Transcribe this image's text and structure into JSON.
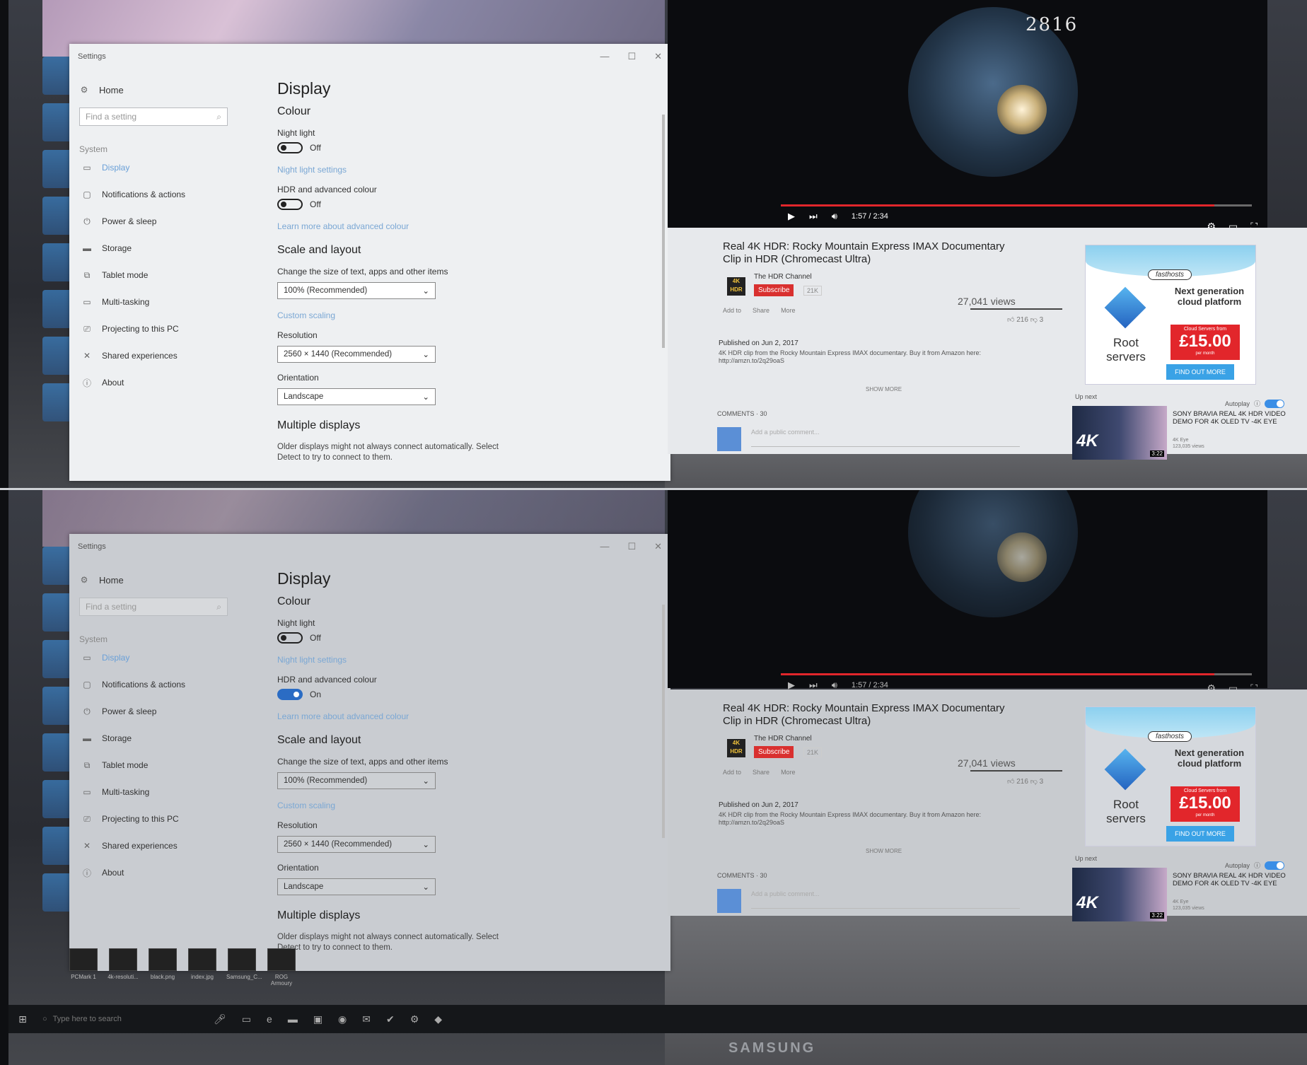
{
  "top": {
    "settings": {
      "title": "Settings",
      "win_controls": [
        "—",
        "☐",
        "✕"
      ],
      "nav": {
        "home": "Home",
        "search_placeholder": "Find a setting",
        "section": "System",
        "items": [
          {
            "label": "Display",
            "icon": "monitor-icon"
          },
          {
            "label": "Notifications & actions",
            "icon": "notification-icon"
          },
          {
            "label": "Power & sleep",
            "icon": "power-icon"
          },
          {
            "label": "Storage",
            "icon": "storage-icon"
          },
          {
            "label": "Tablet mode",
            "icon": "tablet-icon"
          },
          {
            "label": "Multi-tasking",
            "icon": "multitask-icon"
          },
          {
            "label": "Projecting to this PC",
            "icon": "projector-icon"
          },
          {
            "label": "Shared experiences",
            "icon": "shared-icon"
          },
          {
            "label": "About",
            "icon": "info-icon"
          }
        ]
      },
      "content": {
        "heading": "Display",
        "colour": "Colour",
        "night_light_label": "Night light",
        "night_light_state": "Off",
        "night_light_link": "Night light settings",
        "hdr_label": "HDR and advanced colour",
        "hdr_state": "Off",
        "hdr_link": "Learn more about advanced colour",
        "scale_heading": "Scale and layout",
        "scale_label": "Change the size of text, apps and other items",
        "scale_value": "100% (Recommended)",
        "custom_scaling": "Custom scaling",
        "resolution_label": "Resolution",
        "resolution_value": "2560 × 1440 (Recommended)",
        "orientation_label": "Orientation",
        "orientation_value": "Landscape",
        "multi_heading": "Multiple displays",
        "multi_text": "Older displays might not always connect automatically. Select Detect to try to connect to them."
      }
    },
    "video": {
      "number": "2816",
      "time": "1:57 / 2:34",
      "progress": 0.92
    },
    "youtube": {
      "title": "Real 4K HDR: Rocky Mountain Express IMAX Documentary Clip in HDR (Chromecast Ultra)",
      "badge_top": "4K",
      "badge_bottom": "HDR",
      "channel": "The HDR Channel",
      "subscribe": "Subscribe",
      "subcount": "21K",
      "views": "27,041 views",
      "actions": [
        "Add to",
        "Share",
        "More"
      ],
      "likes": "216",
      "dislikes": "3",
      "published": "Published on Jun 2, 2017",
      "description": "4K HDR clip from the Rocky Mountain Express IMAX documentary. Buy it from Amazon here: http://amzn.to/2q29oaS",
      "show_more": "SHOW MORE",
      "comments": "COMMENTS · 30",
      "comment_placeholder": "Add a public comment...",
      "ad": {
        "brand": "fasthosts",
        "headline": "Next generation cloud platform",
        "root": "Root servers",
        "price_top": "Cloud Servers from",
        "price": "£15.00",
        "price_bottom": "per month",
        "button": "FIND OUT MORE"
      },
      "up_next": "Up next",
      "autoplay": "Autoplay",
      "next_title": "SONY BRAVIA REAL 4K HDR VIDEO DEMO FOR 4K OLED TV -4K EYE",
      "next_channel": "4K Eye",
      "next_views": "123,035 views",
      "next_duration": "3:22",
      "thumb_label": "4K"
    }
  },
  "bottom": {
    "settings": {
      "title": "Settings",
      "nav": {
        "home": "Home",
        "search_placeholder": "Find a setting",
        "section": "System",
        "items": [
          {
            "label": "Display"
          },
          {
            "label": "Notifications & actions"
          },
          {
            "label": "Power & sleep"
          },
          {
            "label": "Storage"
          },
          {
            "label": "Tablet mode"
          },
          {
            "label": "Multi-tasking"
          },
          {
            "label": "Projecting to this PC"
          },
          {
            "label": "Shared experiences"
          },
          {
            "label": "About"
          }
        ]
      },
      "content": {
        "heading": "Display",
        "colour": "Colour",
        "night_light_label": "Night light",
        "night_light_state": "Off",
        "night_light_link": "Night light settings",
        "hdr_label": "HDR and advanced colour",
        "hdr_state": "On",
        "hdr_link": "Learn more about advanced colour",
        "scale_heading": "Scale and layout",
        "scale_label": "Change the size of text, apps and other items",
        "scale_value": "100% (Recommended)",
        "custom_scaling": "Custom scaling",
        "resolution_label": "Resolution",
        "resolution_value": "2560 × 1440 (Recommended)",
        "orientation_label": "Orientation",
        "orientation_value": "Landscape",
        "multi_heading": "Multiple displays",
        "multi_text": "Older displays might not always connect automatically. Select Detect to try to connect to them."
      }
    },
    "video": {
      "time": "1:57 / 2:34",
      "progress": 0.92
    },
    "youtube": {
      "title": "Real 4K HDR: Rocky Mountain Express IMAX Documentary Clip in HDR (Chromecast Ultra)",
      "badge_top": "4K",
      "badge_bottom": "HDR",
      "channel": "The HDR Channel",
      "subscribe": "Subscribe",
      "subcount": "21K",
      "views": "27,041 views",
      "actions": [
        "Add to",
        "Share",
        "More"
      ],
      "likes": "216",
      "dislikes": "3",
      "published": "Published on Jun 2, 2017",
      "description": "4K HDR clip from the Rocky Mountain Express IMAX documentary. Buy it from Amazon here: http://amzn.to/2q29oaS",
      "show_more": "SHOW MORE",
      "comments": "COMMENTS · 30",
      "comment_placeholder": "Add a public comment...",
      "ad": {
        "brand": "fasthosts",
        "headline": "Next generation cloud platform",
        "root": "Root servers",
        "price_top": "Cloud Servers from",
        "price": "£15.00",
        "price_bottom": "per month",
        "button": "FIND OUT MORE"
      },
      "up_next": "Up next",
      "autoplay": "Autoplay",
      "next_title": "SONY BRAVIA REAL 4K HDR VIDEO DEMO FOR 4K OLED TV -4K EYE",
      "next_channel": "4K Eye",
      "next_views": "123,035 views",
      "next_duration": "3:22",
      "thumb_label": "4K"
    },
    "desktop_tiles": [
      "PCMark 1",
      "4k-resoluti...",
      "black.png",
      "index.jpg",
      "Samsung_C...",
      "ROG Armoury"
    ],
    "taskbar": {
      "search_placeholder": "Type here to search"
    },
    "brand": "SAMSUNG"
  },
  "colors": {
    "accent": "#2b6cc4",
    "link": "#7aa7d4",
    "youtube_red": "#e1262b",
    "price_red": "#e2262b"
  }
}
